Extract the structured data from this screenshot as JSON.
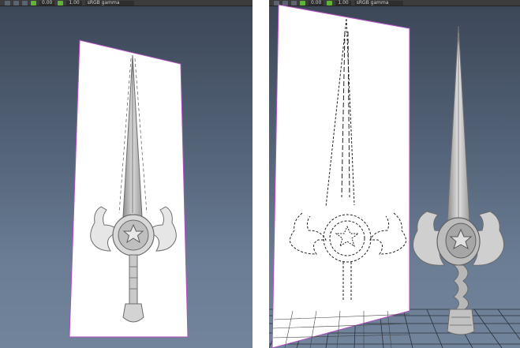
{
  "viewports": [
    {
      "toolbar": {
        "exposure_value": "0.00",
        "gamma_value": "1.00",
        "color_space": "sRGB gamma"
      }
    },
    {
      "toolbar": {
        "exposure_value": "0.00",
        "gamma_value": "1.00",
        "color_space": "sRGB gamma"
      }
    }
  ],
  "icons": [
    "tool-icon",
    "camera-icon",
    "grid-icon",
    "exposure-icon",
    "gamma-icon",
    "dropdown-icon"
  ],
  "colors": {
    "viewport_gradient_top": "#3b4656",
    "viewport_gradient_bottom": "#71849c",
    "image_plane": "#ffffff",
    "image_plane_edge": "#b04fc0",
    "model_gray": "#c4c4c4",
    "grid_line": "#2a2f36",
    "toolbar_bg": "#3c3c3c",
    "status_green": "#5fb338"
  }
}
